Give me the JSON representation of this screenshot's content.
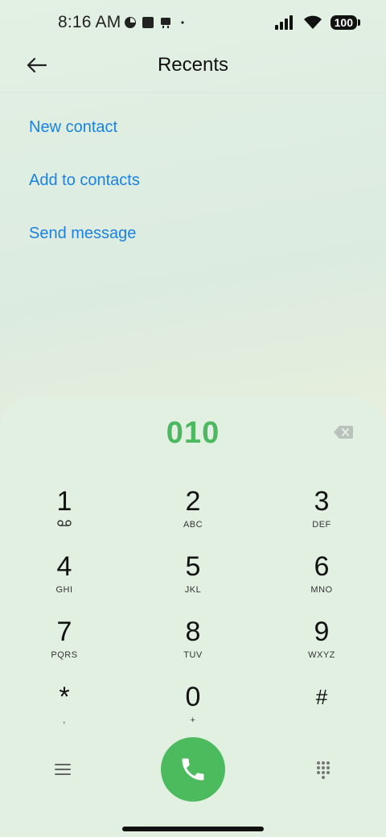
{
  "status_bar": {
    "time": "8:16 AM",
    "battery": "100",
    "icons": [
      "notification-icon",
      "square-icon",
      "robot-icon",
      "dot-icon",
      "signal-icon",
      "wifi-icon",
      "battery-icon"
    ]
  },
  "header": {
    "title": "Recents",
    "back_icon": "back-arrow-icon"
  },
  "actions": [
    {
      "label": "New contact"
    },
    {
      "label": "Add to contacts"
    },
    {
      "label": "Send message"
    }
  ],
  "dialer": {
    "number": "010",
    "keys": [
      {
        "digit": "1",
        "letters": ""
      },
      {
        "digit": "2",
        "letters": "ABC"
      },
      {
        "digit": "3",
        "letters": "DEF"
      },
      {
        "digit": "4",
        "letters": "GHI"
      },
      {
        "digit": "5",
        "letters": "JKL"
      },
      {
        "digit": "6",
        "letters": "MNO"
      },
      {
        "digit": "7",
        "letters": "PQRS"
      },
      {
        "digit": "8",
        "letters": "TUV"
      },
      {
        "digit": "9",
        "letters": "WXYZ"
      },
      {
        "digit": "*",
        "letters": ","
      },
      {
        "digit": "0",
        "letters": "+"
      },
      {
        "digit": "#",
        "letters": ""
      }
    ]
  },
  "colors": {
    "accent_link": "#1a82e0",
    "number_green": "#4cb860",
    "call_green": "#4cbb5e"
  }
}
